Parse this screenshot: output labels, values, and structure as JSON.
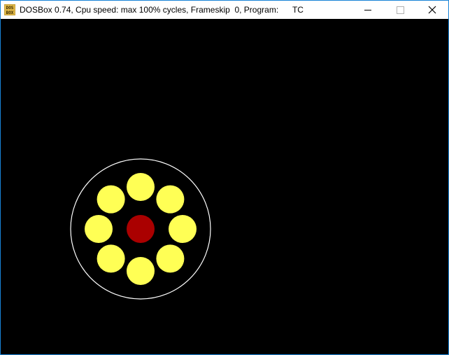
{
  "window": {
    "title": "DOSBox 0.74, Cpu speed: max 100% cycles, Frameskip  0, Program:      TC",
    "icon": "dosbox-icon",
    "icon_text_top": "DOS",
    "icon_text_bottom": "BOX",
    "controls": [
      "minimize-icon",
      "maximize-icon",
      "close-icon"
    ]
  },
  "screen": {
    "background": "#000000",
    "ring_color": "#ffffff",
    "ball_color": "#ffff55",
    "center_color": "#aa0000",
    "ball_count": 8
  }
}
